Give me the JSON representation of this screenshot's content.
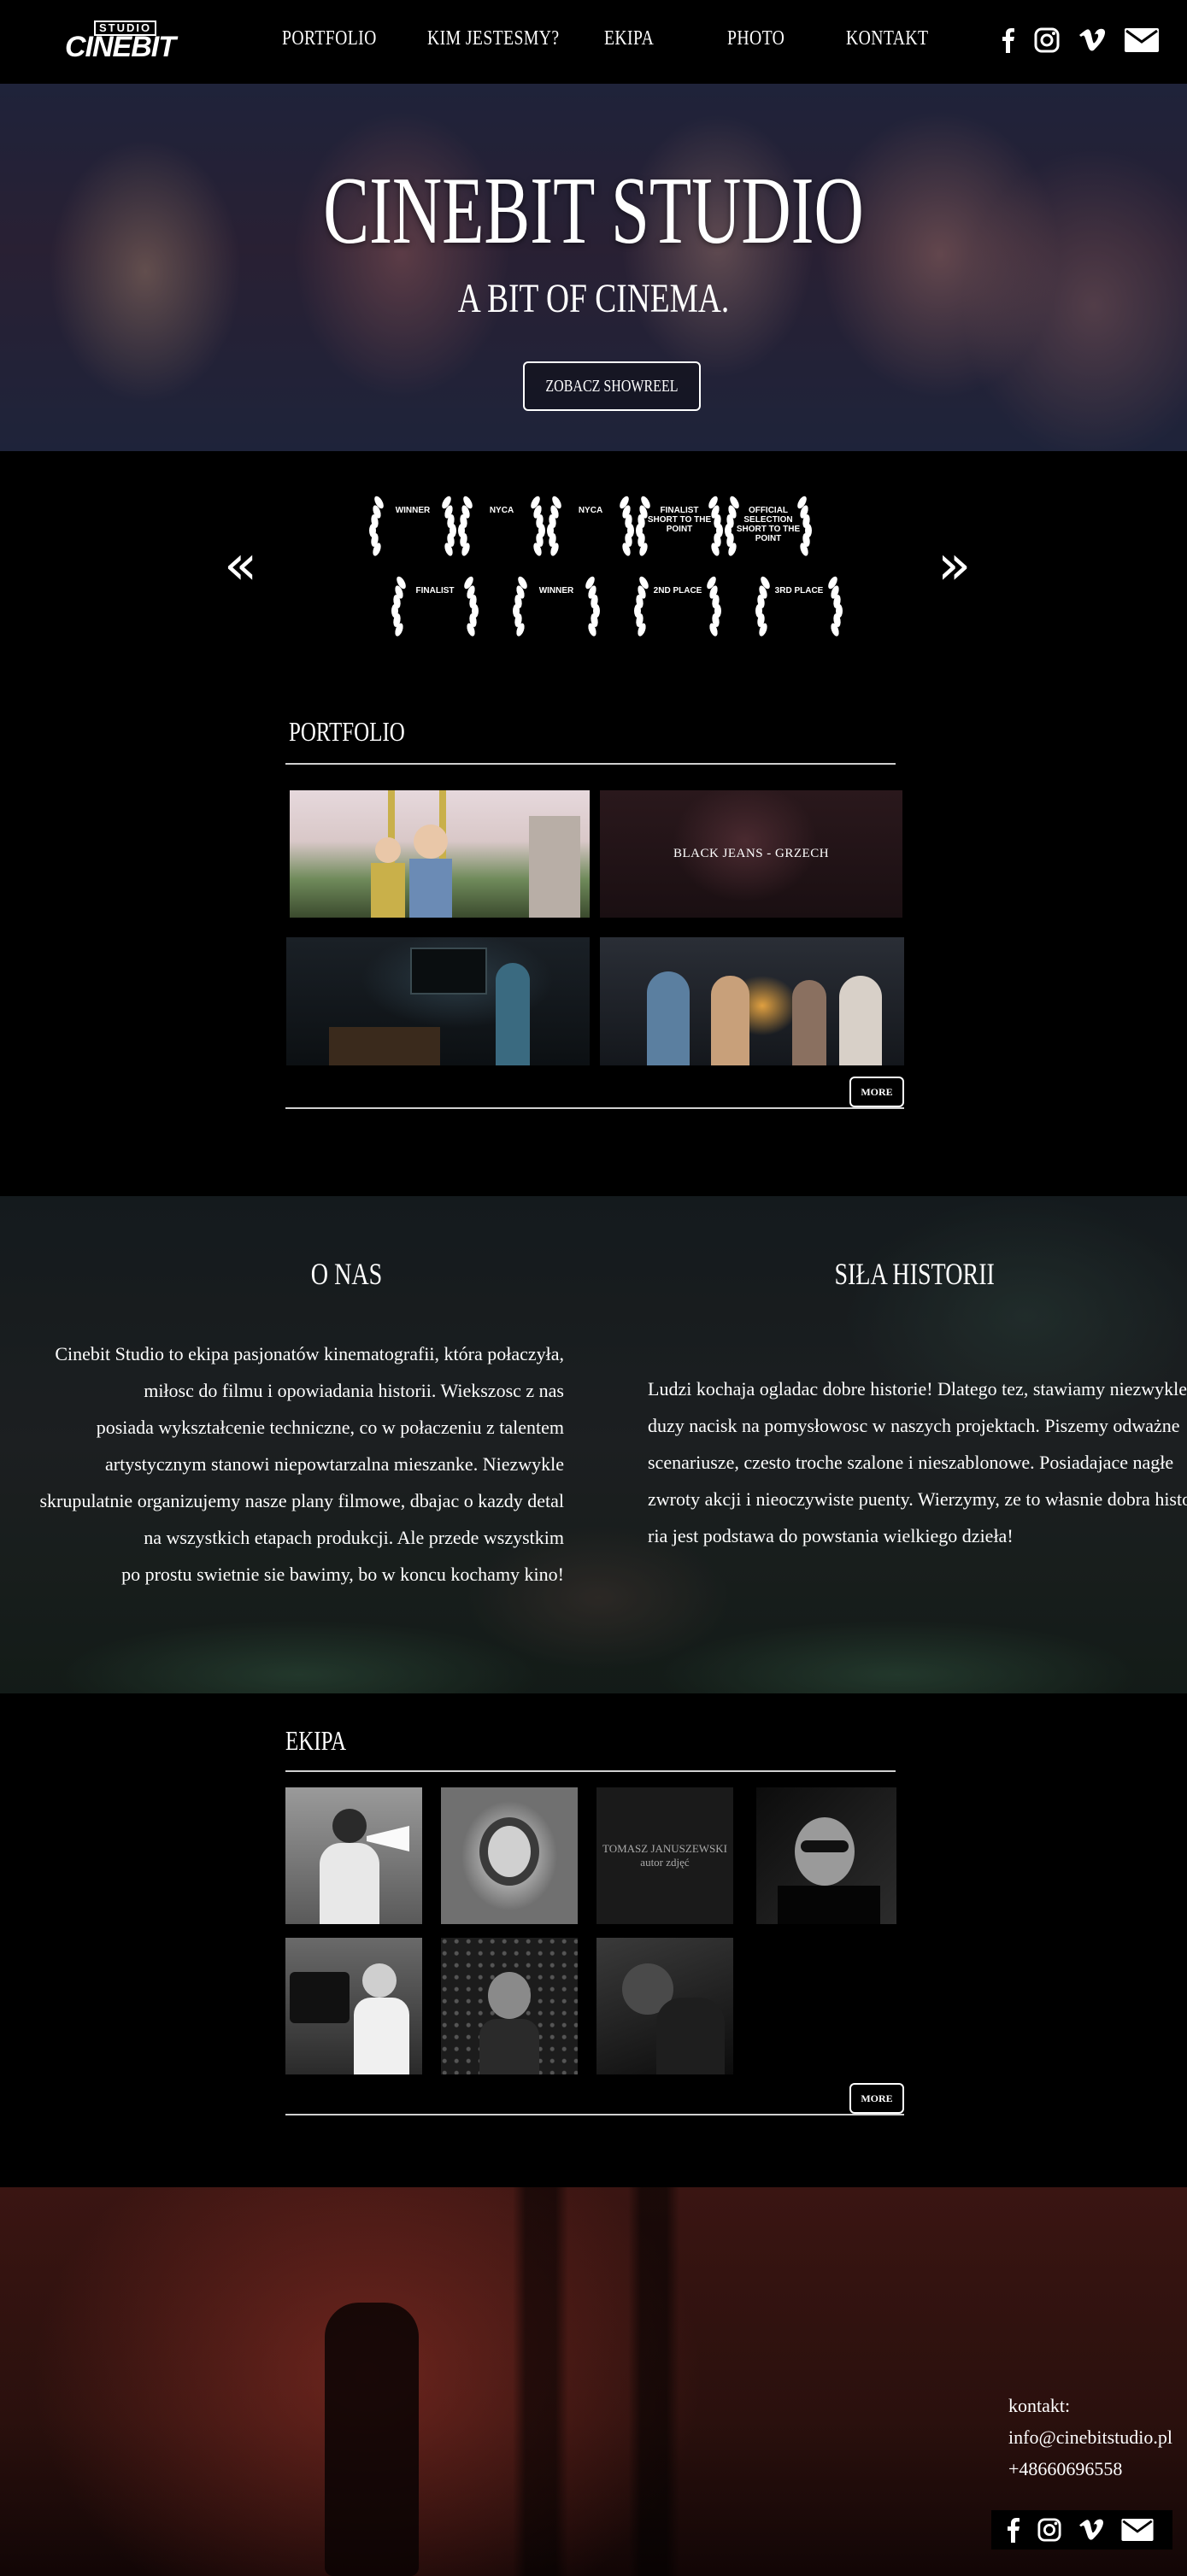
{
  "nav": {
    "logo_top": "STUDIO",
    "logo_main": "CINEBIT",
    "menu": [
      "PORTFOLIO",
      "KIM JESTESMY?",
      "EKIPA",
      "PHOTO",
      "KONTAKT"
    ],
    "social_icons": [
      "facebook-icon",
      "instagram-icon",
      "vimeo-icon",
      "mail-icon"
    ]
  },
  "hero": {
    "title": "CINEBIT STUDIO",
    "subtitle": "A BIT OF CINEMA.",
    "button": "ZOBACZ SHOWREEL"
  },
  "awards": {
    "prev": "«",
    "next": "»",
    "row1": [
      "WINNER",
      "NYCA",
      "NYCA",
      "FINALIST SHORT TO THE POINT",
      "OFFICIAL SELECTION SHORT TO THE POINT"
    ],
    "row2": [
      "FINALIST",
      "WINNER",
      "2ND PLACE",
      "3RD PLACE"
    ]
  },
  "portfolio": {
    "title": "PORTFOLIO",
    "items": [
      "",
      "BLACK JEANS - GRZECH",
      "",
      ""
    ],
    "more": "MORE"
  },
  "about": {
    "left_title": "O NAS",
    "left_lines": [
      "Cinebit Studio to ekipa pasjonatów kinematografii, która połaczyła,",
      "miłosc do filmu i opowiadania historii. Wiekszosc z nas",
      "posiada wykształcenie techniczne, co w połaczeniu z talentem",
      "artystycznym stanowi niepowtarzalna mieszanke. Niezwykle",
      "skrupulatnie organizujemy nasze plany filmowe, dbajac o kazdy detal",
      "na wszystkich etapach produkcji. Ale przede wszystkim",
      "po prostu swietnie sie  bawimy, bo w koncu kochamy kino!"
    ],
    "right_title": "SIŁA HISTORII",
    "right_lines": [
      "Ludzi kochaja ogladac dobre historie! Dlatego tez, stawiamy niezwykle",
      "duzy nacisk na pomysłowosc w naszych projektach. Piszemy odważne",
      "scenariusze, czesto troche szalone i nieszablonowe. Posiadajace nagłe",
      "zwroty akcji i nieoczywiste puenty. Wierzymy, ze to własnie dobra histo-",
      "ria jest podstawa do powstania wielkiego dzieła!"
    ]
  },
  "team": {
    "title": "EKIPA",
    "member_caption_name": "TOMASZ JANUSZEWSKI",
    "member_caption_role": "autor zdjęć",
    "more": "MORE"
  },
  "footer": {
    "contact_label": "kontakt:",
    "email": "info@cinebitstudio.pl",
    "phone": "+48660696558"
  }
}
